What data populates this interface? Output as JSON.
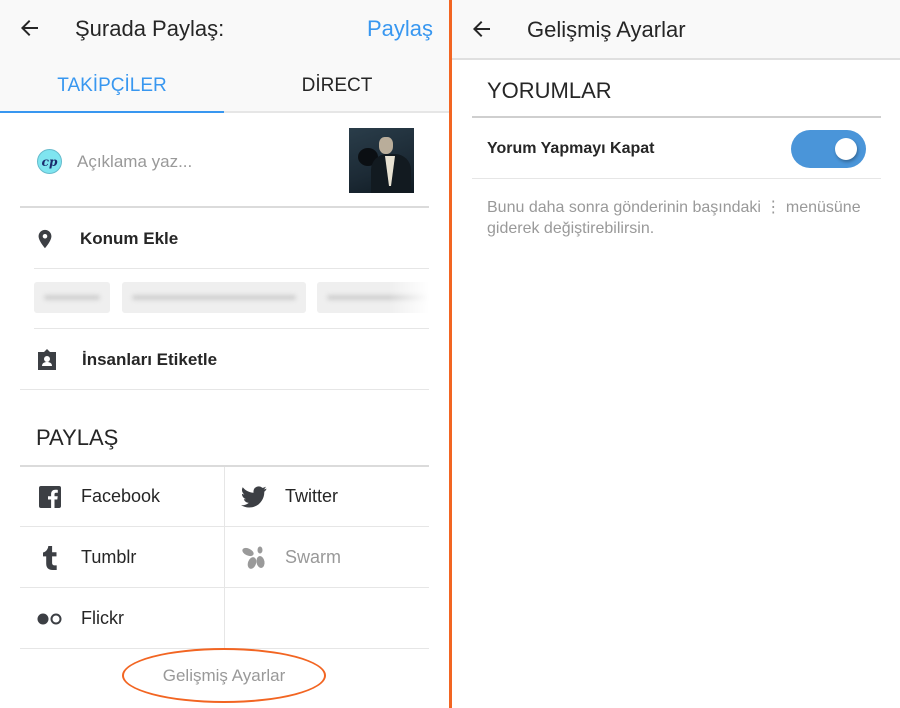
{
  "left_panel": {
    "header": {
      "title": "Şurada Paylaş:",
      "share_label": "Paylaş"
    },
    "tabs": [
      {
        "label": "TAKİPÇİLER",
        "active": true
      },
      {
        "label": "DİRECT",
        "active": false
      }
    ],
    "caption": {
      "avatar_text": "cp",
      "placeholder": "Açıklama yaz...",
      "value": ""
    },
    "location": {
      "label": "Konum Ekle",
      "icon": "location-pin-icon"
    },
    "location_chips": [
      "(blurred)",
      "(blurred)",
      "(blurred)"
    ],
    "tag_people": {
      "label": "İnsanları Etiketle",
      "icon": "tag-person-icon"
    },
    "share_section": {
      "heading": "PAYLAŞ",
      "services": [
        {
          "label": "Facebook",
          "icon": "facebook-icon",
          "enabled": true
        },
        {
          "label": "Twitter",
          "icon": "twitter-icon",
          "enabled": true
        },
        {
          "label": "Tumblr",
          "icon": "tumblr-icon",
          "enabled": true
        },
        {
          "label": "Swarm",
          "icon": "swarm-icon",
          "enabled": false
        },
        {
          "label": "Flickr",
          "icon": "flickr-icon",
          "enabled": true
        }
      ]
    },
    "advanced_link": "Gelişmiş Ayarlar"
  },
  "right_panel": {
    "header": {
      "title": "Gelişmiş Ayarlar"
    },
    "section_heading": "YORUMLAR",
    "setting": {
      "label": "Yorum Yapmayı Kapat",
      "toggle_on": true
    },
    "help_text": "Bunu daha sonra gönderinin başındaki ⋮ menüsüne giderek değiştirebilirsin."
  },
  "colors": {
    "accent_blue": "#3897f0",
    "toggle_blue": "#4a95d9",
    "annotation_orange": "#f26522"
  }
}
